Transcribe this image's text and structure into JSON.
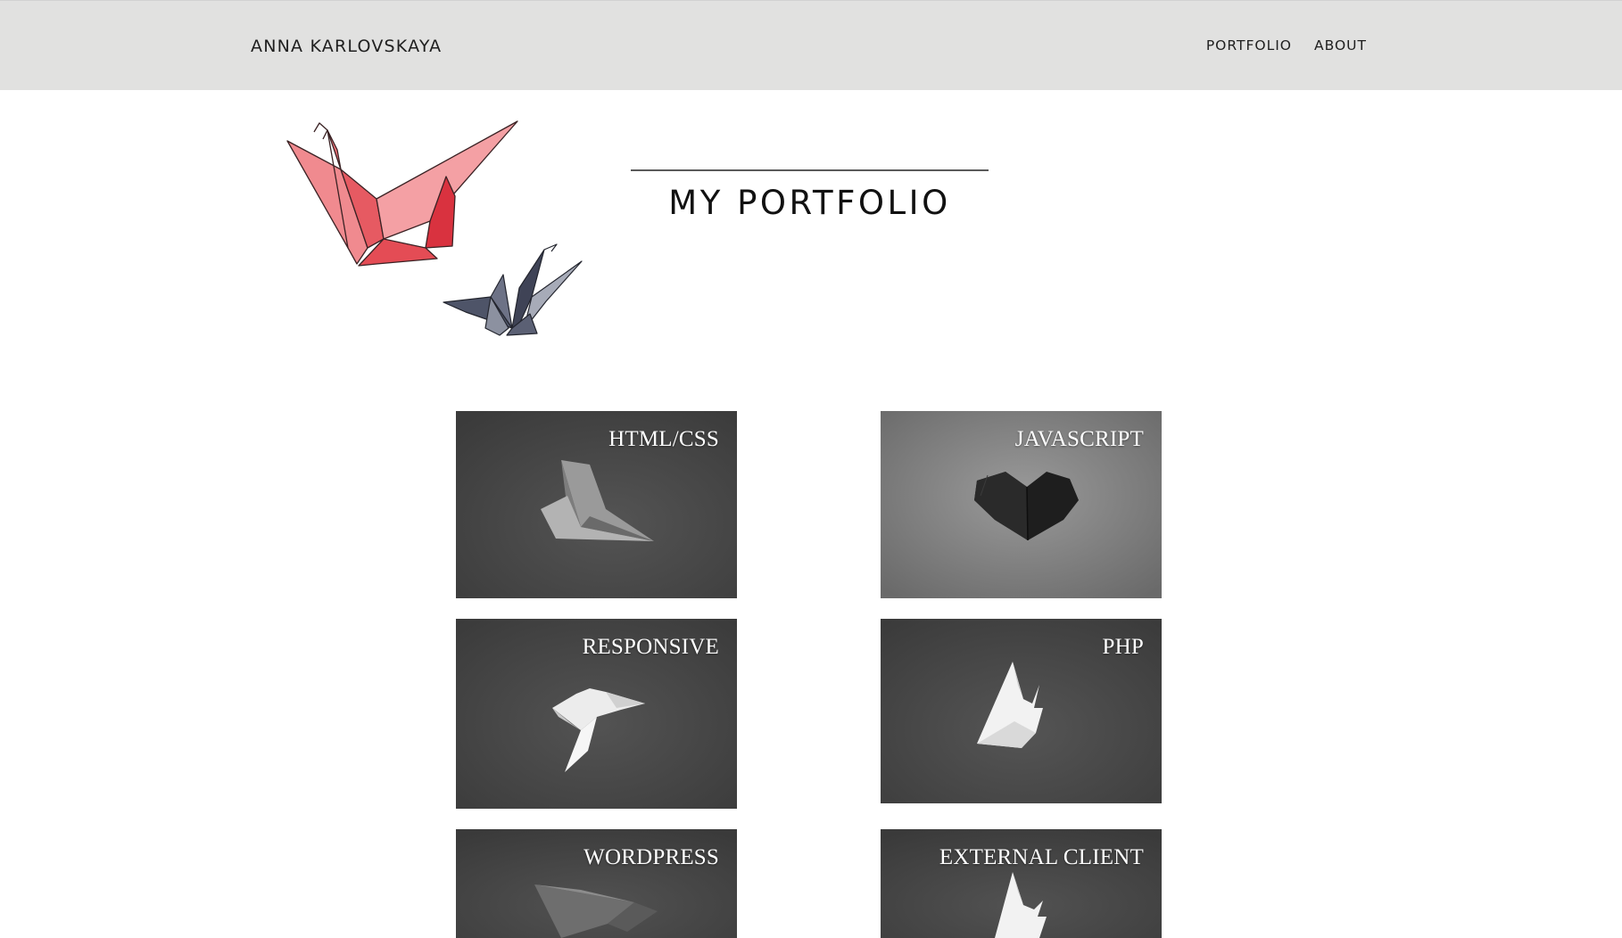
{
  "header": {
    "brand": "ANNA KARLOVSKAYA",
    "nav": [
      {
        "label": "PORTFOLIO"
      },
      {
        "label": "ABOUT"
      }
    ],
    "background": "#e1e1e0"
  },
  "hero": {
    "title": "MY PORTFOLIO",
    "art": "origami-cranes-illustration",
    "crane_colors": [
      "#e8434d",
      "#4a4f63"
    ]
  },
  "tiles": [
    {
      "label": "HTML/CSS",
      "icon": "paper-plane-icon"
    },
    {
      "label": "JAVASCRIPT",
      "icon": "origami-heart-icon"
    },
    {
      "label": "RESPONSIVE",
      "icon": "origami-bird-icon"
    },
    {
      "label": "PHP",
      "icon": "origami-rabbit-icon"
    },
    {
      "label": "WORDPRESS",
      "icon": "paper-plane-icon"
    },
    {
      "label": "EXTERNAL CLIENT",
      "icon": "origami-rabbit-icon"
    }
  ]
}
